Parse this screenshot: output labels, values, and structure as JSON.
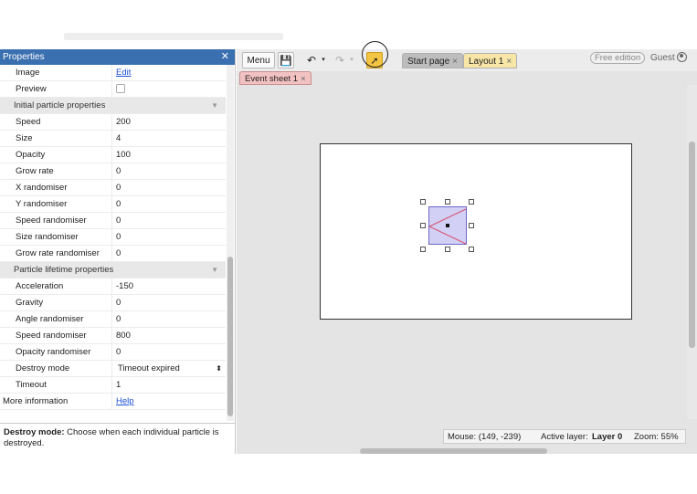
{
  "properties_panel": {
    "title": "Properties",
    "close": "✕",
    "rows": [
      {
        "key": "Image",
        "value": "Edit",
        "kind": "link"
      },
      {
        "key": "Preview",
        "value": "",
        "kind": "checkbox"
      },
      {
        "key": "Initial particle properties",
        "kind": "section"
      },
      {
        "key": "Speed",
        "value": "200"
      },
      {
        "key": "Size",
        "value": "4"
      },
      {
        "key": "Opacity",
        "value": "100"
      },
      {
        "key": "Grow rate",
        "value": "0"
      },
      {
        "key": "X randomiser",
        "value": "0"
      },
      {
        "key": "Y randomiser",
        "value": "0"
      },
      {
        "key": "Speed randomiser",
        "value": "0"
      },
      {
        "key": "Size randomiser",
        "value": "0"
      },
      {
        "key": "Grow rate randomiser",
        "value": "0"
      },
      {
        "key": "Particle lifetime properties",
        "kind": "section"
      },
      {
        "key": "Acceleration",
        "value": "-150"
      },
      {
        "key": "Gravity",
        "value": "0"
      },
      {
        "key": "Angle randomiser",
        "value": "0"
      },
      {
        "key": "Speed randomiser",
        "value": "800"
      },
      {
        "key": "Opacity randomiser",
        "value": "0"
      },
      {
        "key": "Destroy mode",
        "value": "Timeout expired",
        "kind": "select"
      },
      {
        "key": "Timeout",
        "value": "1"
      },
      {
        "key": "More information",
        "value": "Help",
        "kind": "link-nokey"
      }
    ],
    "description": {
      "label": "Destroy mode:",
      "text": "Choose when each individual particle is destroyed."
    }
  },
  "toolbar": {
    "menu_label": "Menu",
    "save_icon": "floppy-disk-icon",
    "undo_icon": "undo-icon",
    "redo_icon": "redo-icon",
    "select_icon": "pointer-icon",
    "tabs": [
      {
        "label": "Start page",
        "close": "×"
      },
      {
        "label": "Layout 1",
        "close": "×"
      }
    ],
    "free_edition": "Free edition",
    "user": "Guest"
  },
  "subtabs": [
    {
      "label": "Event sheet 1",
      "close": "×"
    }
  ],
  "status": {
    "mouse": "Mouse: (149, -239)",
    "active_layer_label": "Active layer:",
    "active_layer": "Layer 0",
    "zoom": "Zoom: 55%"
  },
  "colors": {
    "panel_title": "#3a6fb0",
    "select_tool": "#f4c542",
    "layout_tab": "#f7e6a6",
    "event_tab": "#f2c1c1",
    "particle_fill": "#d2d0f4"
  }
}
